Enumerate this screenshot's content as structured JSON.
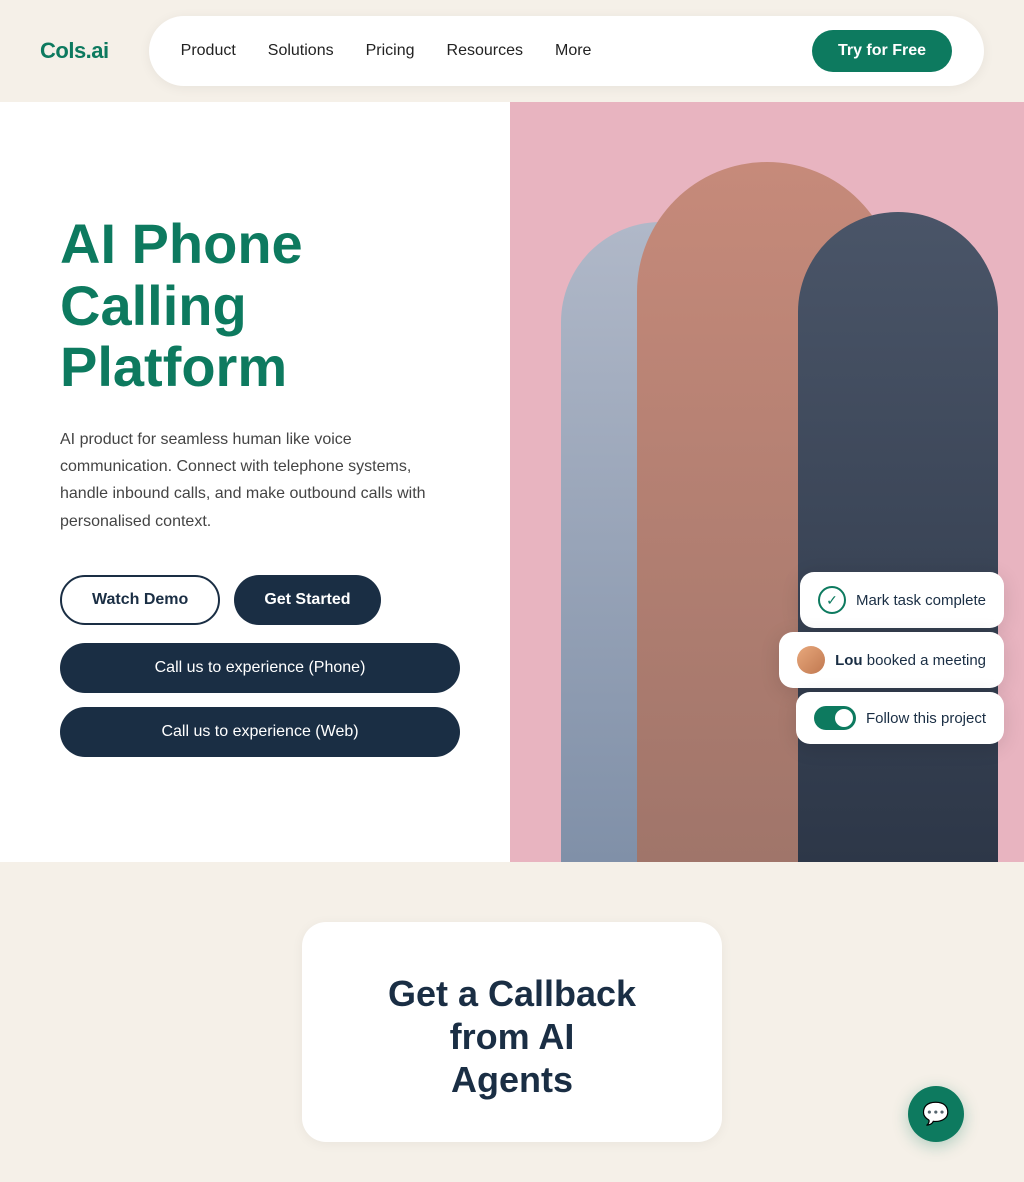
{
  "logo": {
    "text": "Cols.ai"
  },
  "navbar": {
    "links": [
      {
        "label": "Product",
        "id": "product"
      },
      {
        "label": "Solutions",
        "id": "solutions"
      },
      {
        "label": "Pricing",
        "id": "pricing"
      },
      {
        "label": "Resources",
        "id": "resources"
      },
      {
        "label": "More",
        "id": "more"
      }
    ],
    "cta_label": "Try for Free"
  },
  "hero": {
    "title_line1": "AI Phone Calling",
    "title_line2": "Platform",
    "description": "AI product for seamless human like voice communication. Connect with telephone systems, handle inbound calls, and make outbound calls with personalised context.",
    "btn_watch_demo": "Watch Demo",
    "btn_get_started": "Get Started",
    "btn_call_phone": "Call us to experience (Phone)",
    "btn_call_web": "Call us to experience (Web)"
  },
  "ui_overlays": {
    "mark_task": "Mark task complete",
    "booked_prefix": "Lou",
    "booked_suffix": " booked a meeting",
    "follow_project": "Follow this project"
  },
  "bottom": {
    "callback_title_line1": "Get a Callback from AI",
    "callback_title_line2": "Agents"
  },
  "chat_icon": "💬"
}
